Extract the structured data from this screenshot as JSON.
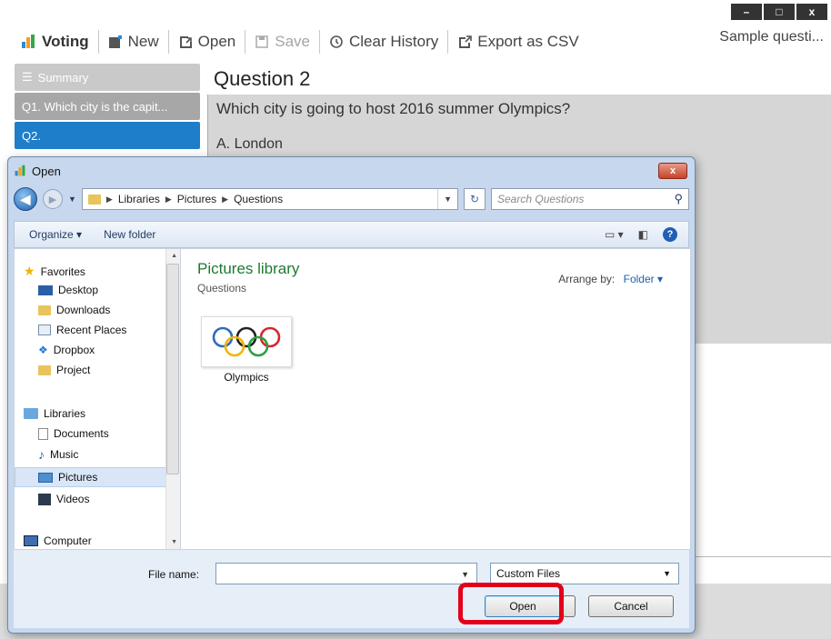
{
  "app": {
    "title": "Voting",
    "sample_label": "Sample questi...",
    "window_controls": [
      "–",
      "□",
      "x"
    ],
    "toolbar": {
      "new": "New",
      "open": "Open",
      "save": "Save",
      "clear_history": "Clear History",
      "export_csv": "Export as CSV"
    },
    "questions": [
      {
        "label": "Summary"
      },
      {
        "label": "Q1. Which city is the capit..."
      },
      {
        "label": "Q2."
      }
    ],
    "question_panel": {
      "title": "Question 2",
      "text": "Which city is going to host 2016 summer Olympics?",
      "answer_a": "A. London"
    }
  },
  "dialog": {
    "title": "Open",
    "close": "x",
    "breadcrumb": [
      "Libraries",
      "Pictures",
      "Questions"
    ],
    "search_placeholder": "Search Questions",
    "organize": "Organize ▾",
    "new_folder": "New folder",
    "nav": {
      "favorites": "Favorites",
      "desktop": "Desktop",
      "downloads": "Downloads",
      "recent_places": "Recent Places",
      "dropbox": "Dropbox",
      "project": "Project",
      "libraries": "Libraries",
      "documents": "Documents",
      "music": "Music",
      "pictures": "Pictures",
      "videos": "Videos",
      "computer": "Computer"
    },
    "library_title": "Pictures library",
    "library_sub": "Questions",
    "arrange_label": "Arrange by:",
    "arrange_value": "Folder ▾",
    "file_item": "Olympics",
    "file_name_label": "File name:",
    "file_name_value": "",
    "filter_value": "Custom Files",
    "open_button": "Open",
    "cancel_button": "Cancel"
  }
}
